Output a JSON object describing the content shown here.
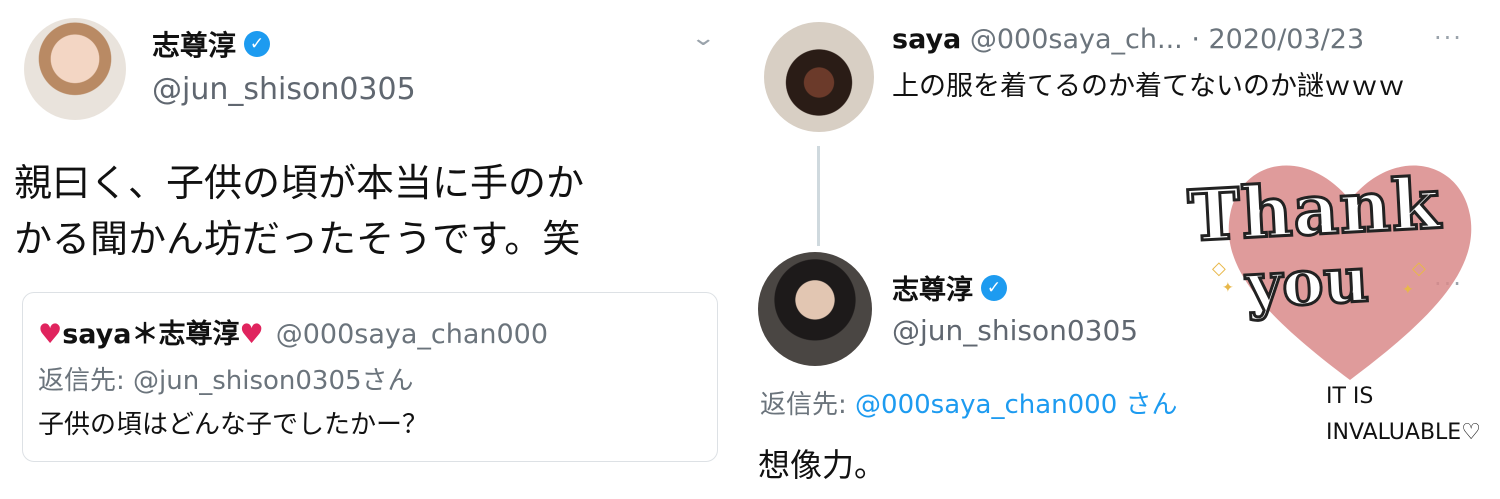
{
  "left_tweet": {
    "name": "志尊淳",
    "verified_icon": "verified-badge-icon",
    "handle": "@jun_shison0305",
    "chevron_icon": "chevron-down-icon",
    "body_line1": "親曰く、子供の頃が本当に手のか",
    "body_line2": "かる聞かん坊だったそうです。笑",
    "quote": {
      "heart": "♥",
      "name": "saya＊志尊淳",
      "handle": "@000saya_chan000",
      "reply_line": "返信先: @jun_shison0305さん",
      "body": "子供の頃はどんな子でしたかー？"
    }
  },
  "right_thread": {
    "saya": {
      "name": "saya",
      "meta": "@000saya_ch... · 2020/03/23",
      "more": "···",
      "body": "上の服を着てるのか着てないのか謎ｗｗｗ"
    },
    "jun": {
      "name": "志尊淳",
      "handle": "@jun_shison0305",
      "more": "···",
      "reply_prefix": "返信先: ",
      "reply_target": "@000saya_chan000 さん",
      "body": "想像力。"
    }
  },
  "sticker": {
    "thank": "Thank",
    "you": "you",
    "line1": "IT IS",
    "line2": "INVALUABLE♡"
  },
  "colors": {
    "verified": "#1d9bf0",
    "heart": "#e0245e",
    "secondary_text": "#6b747c",
    "sticker_heart": "#d98a8a"
  }
}
